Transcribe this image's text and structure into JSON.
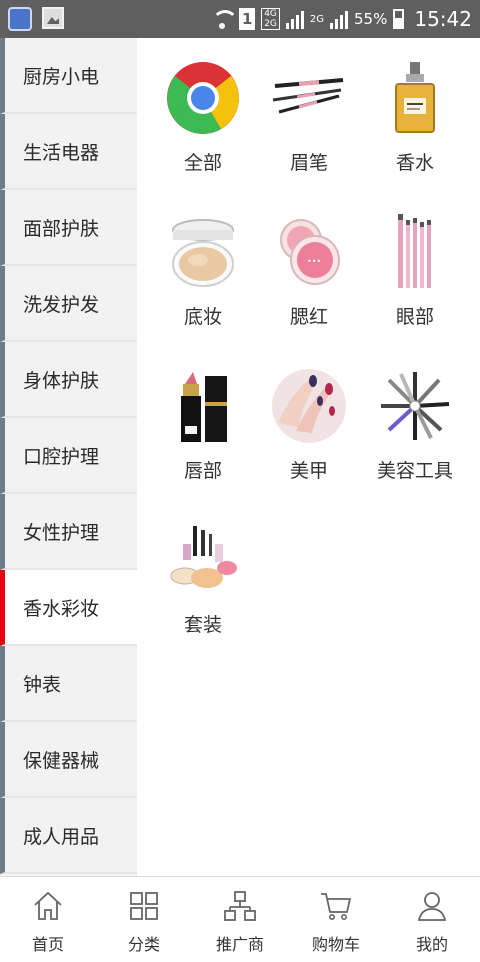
{
  "status_bar": {
    "network_top": "4G",
    "network_bottom": "2G",
    "sim": "1",
    "network2": "2G",
    "battery": "55%",
    "time": "15:42"
  },
  "sidebar": {
    "items": [
      {
        "label": "厨房小电"
      },
      {
        "label": "生活电器"
      },
      {
        "label": "面部护肤"
      },
      {
        "label": "洗发护发"
      },
      {
        "label": "身体护肤"
      },
      {
        "label": "口腔护理"
      },
      {
        "label": "女性护理"
      },
      {
        "label": "香水彩妆"
      },
      {
        "label": "钟表"
      },
      {
        "label": "保健器械"
      },
      {
        "label": "成人用品"
      }
    ],
    "active_index": 7,
    "active_color": "#e60012"
  },
  "categories": [
    {
      "label": "全部",
      "icon": "chrome-icon"
    },
    {
      "label": "眉笔",
      "icon": "eyebrow-pencil-icon"
    },
    {
      "label": "香水",
      "icon": "perfume-bottle-icon"
    },
    {
      "label": "底妆",
      "icon": "cushion-compact-icon"
    },
    {
      "label": "腮红",
      "icon": "blush-compact-icon"
    },
    {
      "label": "眼部",
      "icon": "eye-brushes-icon"
    },
    {
      "label": "唇部",
      "icon": "lipstick-icon"
    },
    {
      "label": "美甲",
      "icon": "nail-art-icon"
    },
    {
      "label": "美容工具",
      "icon": "beauty-tools-icon"
    },
    {
      "label": "套装",
      "icon": "makeup-set-icon"
    }
  ],
  "bottom_nav": {
    "items": [
      {
        "label": "首页",
        "icon": "home-icon"
      },
      {
        "label": "分类",
        "icon": "grid-icon"
      },
      {
        "label": "推广商",
        "icon": "org-chart-icon"
      },
      {
        "label": "购物车",
        "icon": "cart-icon"
      },
      {
        "label": "我的",
        "icon": "user-icon"
      }
    ]
  }
}
